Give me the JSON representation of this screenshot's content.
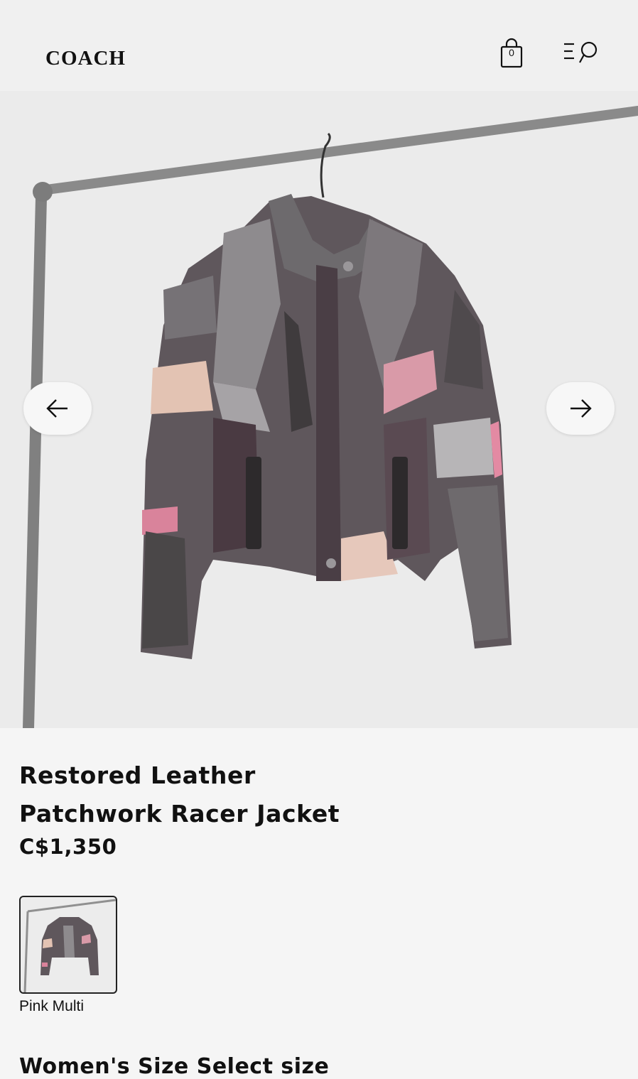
{
  "header": {
    "logo": "COACH",
    "bag_count": "0",
    "bag_icon": "shopping-bag-icon",
    "menu_icon": "menu-search-icon"
  },
  "gallery": {
    "prev_icon": "arrow-left-icon",
    "next_icon": "arrow-right-icon"
  },
  "product": {
    "title_line1": "Restored Leather",
    "title_line2": "Patchwork Racer Jacket",
    "price": "C$1,350"
  },
  "swatches": [
    {
      "label": "Pink Multi",
      "selected": true
    }
  ],
  "size_section": {
    "heading": "Women's Size Select size"
  }
}
